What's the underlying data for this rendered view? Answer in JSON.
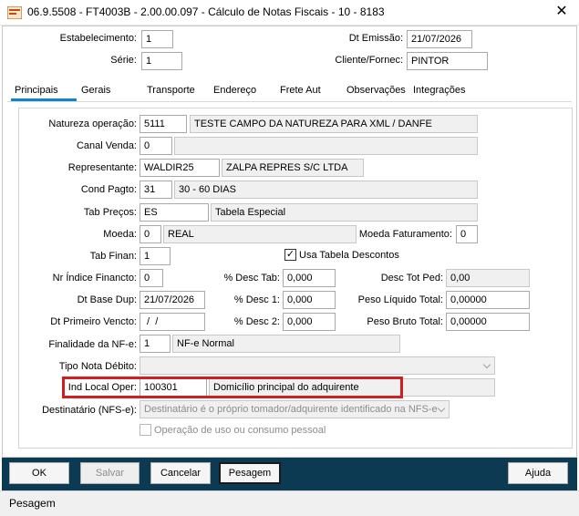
{
  "window": {
    "title": "06.9.5508 - FT4003B - 2.00.00.097 - Cálculo de Notas Fiscais - 10 - 8183",
    "close_glyph": "✕"
  },
  "header": {
    "estabelecimento_label": "Estabelecimento:",
    "estabelecimento_value": "1",
    "serie_label": "Série:",
    "serie_value": "1",
    "dt_emissao_label": "Dt Emissão:",
    "dt_emissao_value": "21/07/2026",
    "cliente_label": "Cliente/Fornec:",
    "cliente_value": "PINTOR"
  },
  "tabs": [
    {
      "label": "Principais",
      "active": true
    },
    {
      "label": "Gerais"
    },
    {
      "label": "Transporte"
    },
    {
      "label": "Endereço"
    },
    {
      "label": "Frete Aut"
    },
    {
      "label": "Observações"
    },
    {
      "label": "Integrações"
    }
  ],
  "form": {
    "natureza_label": "Natureza operação:",
    "natureza_code": "5111",
    "natureza_desc": "TESTE CAMPO DA NATUREZA PARA XML / DANFE",
    "canal_label": "Canal Venda:",
    "canal_value": "0",
    "representante_label": "Representante:",
    "representante_code": "WALDIR25",
    "representante_desc": "ZALPA REPRES S/C LTDA",
    "cond_label": "Cond Pagto:",
    "cond_code": "31",
    "cond_desc": "30 - 60 DIAS",
    "tab_precos_label": "Tab Preços:",
    "tab_precos_code": "ES",
    "tab_precos_desc": "Tabela Especial",
    "moeda_label": "Moeda:",
    "moeda_code": "0",
    "moeda_desc": "REAL",
    "moeda_fat_label": "Moeda Faturamento:",
    "moeda_fat_value": "0",
    "tab_finan_label": "Tab Finan:",
    "tab_finan_value": "1",
    "usa_tabela_label": "Usa Tabela Descontos",
    "usa_tabela_checked": "✓",
    "nr_indice_label": "Nr Índice Financto:",
    "nr_indice_value": "0",
    "desc_tab_label": "% Desc Tab:",
    "desc_tab_value": "0,000",
    "desc_tot_ped_label": "Desc Tot Ped:",
    "desc_tot_ped_value": "0,00",
    "dt_base_label": "Dt Base Dup:",
    "dt_base_value": "21/07/2026",
    "desc1_label": "% Desc 1:",
    "desc1_value": "0,000",
    "peso_liq_label": "Peso Líquido Total:",
    "peso_liq_value": "0,00000",
    "dt_primeiro_label": "Dt Primeiro Vencto:",
    "dt_primeiro_value": " /  /",
    "desc2_label": "% Desc 2:",
    "desc2_value": "0,000",
    "peso_bruto_label": "Peso Bruto Total:",
    "peso_bruto_value": "0,00000",
    "finalidade_label": "Finalidade da NF-e:",
    "finalidade_code": "1",
    "finalidade_desc": "NF-e Normal",
    "tipo_nota_label": "Tipo Nota Débito:",
    "tipo_nota_value": "",
    "ind_local_label": "Ind Local Oper:",
    "ind_local_code": "100301",
    "ind_local_desc": "Domicílio principal do adquirente",
    "destinatario_label": "Destinatário (NFS-e):",
    "destinatario_value": "Destinatário é o próprio tomador/adquirente identificado na NFS-e",
    "operacao_label": "Operação de uso ou consumo pessoal"
  },
  "buttons": {
    "ok": "OK",
    "salvar": "Salvar",
    "cancelar": "Cancelar",
    "pesagem": "Pesagem",
    "ajuda": "Ajuda"
  },
  "status": {
    "text": "Pesagem"
  },
  "colors": {
    "button_bar": "#0c3a52",
    "tab_accent": "#0f88c9",
    "highlight": "#d11f1f"
  }
}
